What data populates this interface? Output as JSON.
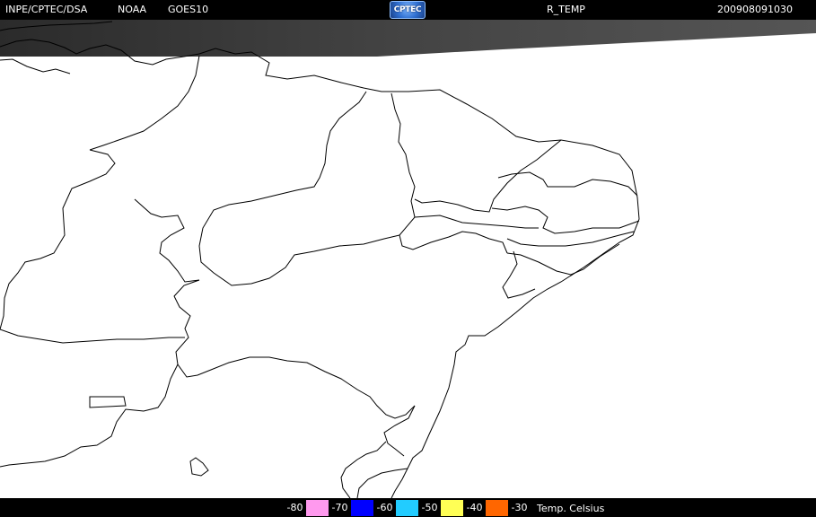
{
  "header": {
    "source": "INPE/CPTEC/DSA",
    "agency": "NOAA",
    "satellite": "GOES10",
    "logo_text": "CPTEC",
    "product": "R_TEMP",
    "timestamp": "200908091030"
  },
  "map": {
    "background_color": "#ffffff",
    "border_color": "#000000",
    "cloud_band_color": "#3a3a3a"
  },
  "legend": {
    "items": [
      {
        "label": "-80",
        "color": "#ff99ee"
      },
      {
        "label": "-70",
        "color": "#0000ff"
      },
      {
        "label": "-60",
        "color": "#22ccff"
      },
      {
        "label": "-50",
        "color": "#ffff55"
      },
      {
        "label": "-40",
        "color": "#ff6600"
      },
      {
        "label": "-30",
        "color": ""
      }
    ],
    "caption": "Temp. Celsius"
  }
}
